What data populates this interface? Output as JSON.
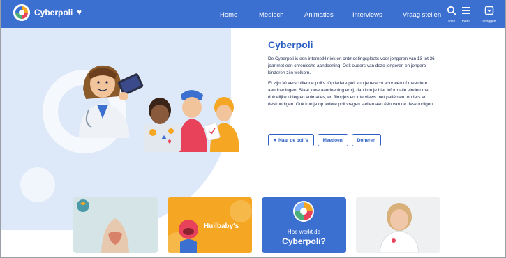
{
  "header": {
    "brand": "Cyberpoli",
    "nav": [
      "Home",
      "Medisch",
      "Animaties",
      "Interviews",
      "Vraag stellen"
    ],
    "tools": {
      "search_label": "zoek",
      "menu_label": "menu",
      "login_label": "inloggen"
    }
  },
  "hero": {
    "title": "Cyberpoli",
    "paragraphs": [
      "De Cyberpoli is een internetkliniek en ontmoetingsplaats voor jongeren van 13 tot 26 jaar met een chronische aandoening. Ook ouders van deze jongeren en jongere kinderen zijn welkom.",
      "Er zijn 30 verschillende poli's. Op iedere poli kun je terecht voor één of meerdere aandoeningen. Staat jouw aandoening erbij, dan kun je hier informatie vinden met duidelijke uitleg en animaties, en filmpjes en interviews met patiënten, ouders en deskundigen. Ook kun je op iedere poli vragen stellen aan één van de deskundigen."
    ],
    "buttons": {
      "polis": "Naar de poli's",
      "join": "Meedoen",
      "donate": "Doneren"
    }
  },
  "cards": {
    "huilbaby": "Huilbaby's",
    "how_line1": "Hoe werkt de",
    "how_line2": "Cyberpoli?"
  },
  "colors": {
    "brand_blue": "#3b6fd0",
    "title_blue": "#2b5fc4",
    "hero_bg": "#dde8f8",
    "orange": "#f5a623"
  }
}
